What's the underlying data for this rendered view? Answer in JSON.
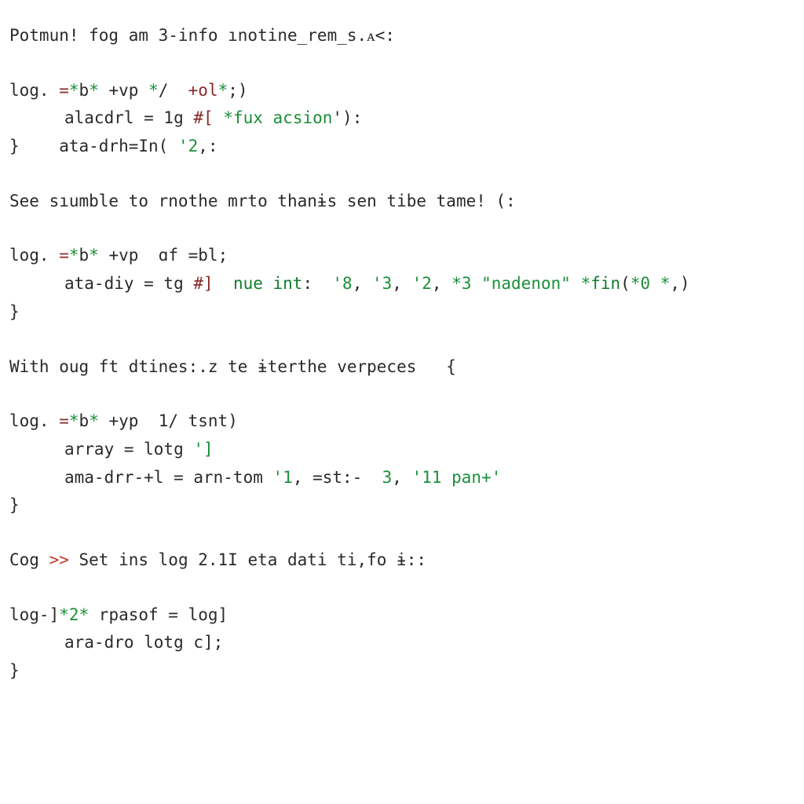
{
  "blocks": [
    {
      "prose": "Potmun! fog am 3-info ınotine_rem_s.ᴀ<:",
      "code": [
        {
          "segments": [
            {
              "t": "log. ",
              "c": ""
            },
            {
              "t": "=",
              "c": "op"
            },
            {
              "t": "*",
              "c": "num"
            },
            {
              "t": "b",
              "c": ""
            },
            {
              "t": "* ",
              "c": "num"
            },
            {
              "t": "+vp ",
              "c": ""
            },
            {
              "t": "*",
              "c": "num"
            },
            {
              "t": "/  ",
              "c": ""
            },
            {
              "t": "+ol",
              "c": "op"
            },
            {
              "t": "*",
              "c": "num"
            },
            {
              "t": ";)",
              "c": ""
            }
          ]
        },
        {
          "indent": true,
          "segments": [
            {
              "t": "alacdrl = 1g ",
              "c": ""
            },
            {
              "t": "#[ ",
              "c": "op"
            },
            {
              "t": "*",
              "c": "num"
            },
            {
              "t": "fux acsion",
              "c": "str"
            },
            {
              "t": "'):",
              "c": ""
            }
          ]
        },
        {
          "segments": [
            {
              "t": "}    ",
              "c": "brace"
            },
            {
              "t": "ata-drh=In( ",
              "c": ""
            },
            {
              "t": "'2",
              "c": "str"
            },
            {
              "t": ",:",
              "c": ""
            }
          ]
        }
      ]
    },
    {
      "prose": "See sıumble to rnothe mrto thanɨs sen tibe tame! (:",
      "code": [
        {
          "segments": [
            {
              "t": "log. ",
              "c": ""
            },
            {
              "t": "=",
              "c": "op"
            },
            {
              "t": "*",
              "c": "num"
            },
            {
              "t": "b",
              "c": ""
            },
            {
              "t": "* ",
              "c": "num"
            },
            {
              "t": "+vp  ",
              "c": ""
            },
            {
              "t": "ɑf ",
              "c": ""
            },
            {
              "t": "=bl;",
              "c": ""
            }
          ]
        },
        {
          "indent": true,
          "segments": [
            {
              "t": "ata-diy = tg ",
              "c": ""
            },
            {
              "t": "#]  ",
              "c": "op"
            },
            {
              "t": "nue int",
              "c": "kw"
            },
            {
              "t": ":  ",
              "c": ""
            },
            {
              "t": "'8",
              "c": "str"
            },
            {
              "t": ", ",
              "c": ""
            },
            {
              "t": "'3",
              "c": "str"
            },
            {
              "t": ", ",
              "c": ""
            },
            {
              "t": "'2",
              "c": "str"
            },
            {
              "t": ", ",
              "c": ""
            },
            {
              "t": "*3 ",
              "c": "num"
            },
            {
              "t": "\"nadenon\"",
              "c": "str"
            },
            {
              "t": " *",
              "c": "num"
            },
            {
              "t": "fin",
              "c": "kw"
            },
            {
              "t": "(",
              "c": ""
            },
            {
              "t": "*0 *",
              "c": "num"
            },
            {
              "t": ",)",
              "c": ""
            }
          ]
        },
        {
          "segments": [
            {
              "t": "}",
              "c": "brace"
            }
          ]
        }
      ]
    },
    {
      "prose": "With oug ft dtines:.z te ɨterthe verpeces   {",
      "code": [
        {
          "segments": [
            {
              "t": "log. ",
              "c": ""
            },
            {
              "t": "=",
              "c": "op"
            },
            {
              "t": "*",
              "c": "num"
            },
            {
              "t": "b",
              "c": ""
            },
            {
              "t": "* ",
              "c": "num"
            },
            {
              "t": "+yp  ",
              "c": ""
            },
            {
              "t": "1/ tsnt)",
              "c": ""
            }
          ]
        },
        {
          "indent": true,
          "segments": [
            {
              "t": "array = lotg ",
              "c": ""
            },
            {
              "t": "']",
              "c": "str"
            }
          ]
        },
        {
          "indent": true,
          "segments": [
            {
              "t": "ama-drr-+l = arn-tom ",
              "c": ""
            },
            {
              "t": "'1",
              "c": "str"
            },
            {
              "t": ", ",
              "c": ""
            },
            {
              "t": "=st:- ",
              "c": ""
            },
            {
              "t": " 3",
              "c": "num"
            },
            {
              "t": ", ",
              "c": ""
            },
            {
              "t": "'11 pan+'",
              "c": "str"
            }
          ]
        },
        {
          "segments": [
            {
              "t": "}",
              "c": "brace"
            }
          ]
        }
      ]
    },
    {
      "segments_prose": [
        {
          "t": "Cog ",
          "c": ""
        },
        {
          "t": ">> ",
          "c": "arrow"
        },
        {
          "t": "Set ins log 2.1I eta dati ti,fo ɨ::",
          "c": ""
        }
      ],
      "code": [
        {
          "segments": [
            {
              "t": "log-]",
              "c": ""
            },
            {
              "t": "*2*",
              "c": "num"
            },
            {
              "t": " rpasof = log]",
              "c": ""
            }
          ]
        },
        {
          "indent": true,
          "segments": [
            {
              "t": "ara-dro lotg c];",
              "c": ""
            }
          ]
        },
        {
          "segments": [
            {
              "t": "}",
              "c": "brace"
            }
          ]
        }
      ]
    }
  ]
}
